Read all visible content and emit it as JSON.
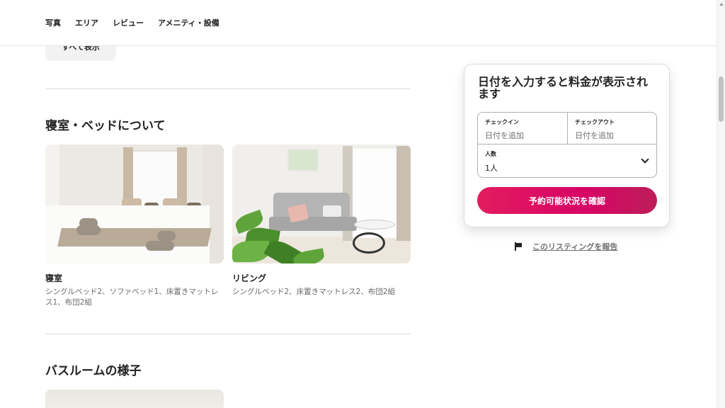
{
  "nav": {
    "items": [
      "写真",
      "エリア",
      "レビュー",
      "アメニティ・設備"
    ]
  },
  "show_all_label": "すべて表示",
  "sleeping": {
    "title": "寝室・ベッドについて",
    "rooms": [
      {
        "name": "寝室",
        "beds": "シングルベッド2、ソファベッド1、床置きマットレス1、布団2組"
      },
      {
        "name": "リビング",
        "beds": "シングルベッド2、床置きマットレス2、布団2組"
      }
    ]
  },
  "bathroom": {
    "title": "バスルームの様子"
  },
  "booking": {
    "heading": "日付を入力すると料金が表示されます",
    "checkin_label": "チェックイン",
    "checkin_placeholder": "日付を追加",
    "checkout_label": "チェックアウト",
    "checkout_placeholder": "日付を追加",
    "guests_label": "人数",
    "guests_value": "1人",
    "cta_label": "予約可能状況を確認"
  },
  "report_label": "このリスティングを報告",
  "colors": {
    "cta_start": "#e31c5f",
    "cta_end": "#bd1e59",
    "text": "#222222",
    "muted": "#6a6a6a"
  }
}
